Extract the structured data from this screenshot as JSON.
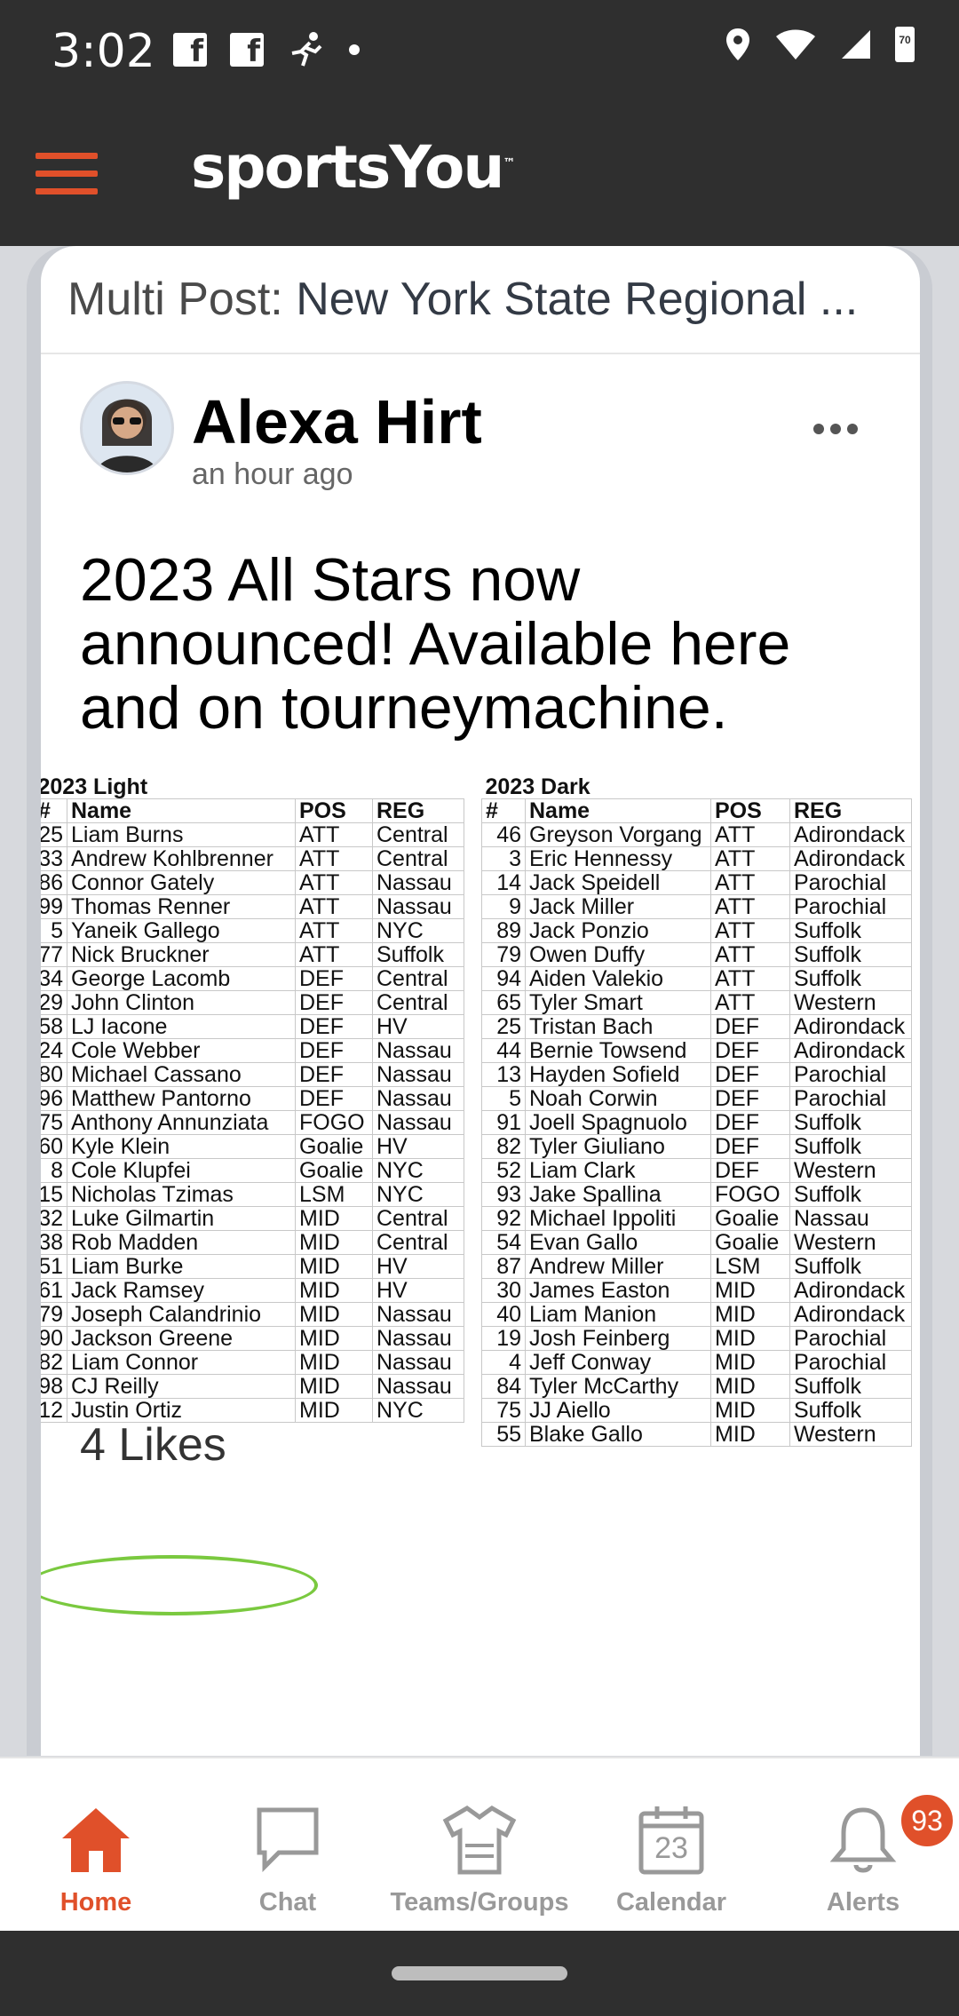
{
  "status": {
    "time": "3:02",
    "battery": "70"
  },
  "app": {
    "brand": "sportsYou",
    "brand_mark": "™"
  },
  "post": {
    "multi_prefix": "Multi Post:",
    "multi_title": "New York State Regional ...",
    "author": "Alexa Hirt",
    "time": "an hour ago",
    "text": "2023 All Stars now announced! Available here and on tourneymachine.",
    "likes": "4 Likes"
  },
  "light_table": {
    "title": "2023 Light",
    "headers": [
      "#",
      "Name",
      "POS",
      "REG"
    ],
    "rows": [
      [
        "25",
        "Liam Burns",
        "ATT",
        "Central"
      ],
      [
        "33",
        "Andrew Kohlbrenner",
        "ATT",
        "Central"
      ],
      [
        "86",
        "Connor Gately",
        "ATT",
        "Nassau"
      ],
      [
        "99",
        "Thomas Renner",
        "ATT",
        "Nassau"
      ],
      [
        "5",
        "Yaneik Gallego",
        "ATT",
        "NYC"
      ],
      [
        "77",
        "Nick Bruckner",
        "ATT",
        "Suffolk"
      ],
      [
        "34",
        "George Lacomb",
        "DEF",
        "Central"
      ],
      [
        "29",
        "John Clinton",
        "DEF",
        "Central"
      ],
      [
        "58",
        "LJ Iacone",
        "DEF",
        "HV"
      ],
      [
        "24",
        "Cole Webber",
        "DEF",
        "Nassau"
      ],
      [
        "80",
        "Michael Cassano",
        "DEF",
        "Nassau"
      ],
      [
        "96",
        "Matthew Pantorno",
        "DEF",
        "Nassau"
      ],
      [
        "75",
        "Anthony Annunziata",
        "FOGO",
        "Nassau"
      ],
      [
        "60",
        "Kyle Klein",
        "Goalie",
        "HV"
      ],
      [
        "8",
        "Cole Klupfei",
        "Goalie",
        "NYC"
      ],
      [
        "15",
        "Nicholas Tzimas",
        "LSM",
        "NYC"
      ],
      [
        "32",
        "Luke Gilmartin",
        "MID",
        "Central"
      ],
      [
        "38",
        "Rob Madden",
        "MID",
        "Central"
      ],
      [
        "51",
        "Liam Burke",
        "MID",
        "HV"
      ],
      [
        "61",
        "Jack Ramsey",
        "MID",
        "HV"
      ],
      [
        "79",
        "Joseph Calandrinio",
        "MID",
        "Nassau"
      ],
      [
        "90",
        "Jackson Greene",
        "MID",
        "Nassau"
      ],
      [
        "82",
        "Liam Connor",
        "MID",
        "Nassau"
      ],
      [
        "98",
        "CJ Reilly",
        "MID",
        "Nassau"
      ],
      [
        "12",
        "Justin Ortiz",
        "MID",
        "NYC"
      ]
    ]
  },
  "dark_table": {
    "title": "2023 Dark",
    "headers": [
      "#",
      "Name",
      "POS",
      "REG"
    ],
    "rows": [
      [
        "46",
        "Greyson Vorgang",
        "ATT",
        "Adirondack"
      ],
      [
        "3",
        "Eric Hennessy",
        "ATT",
        "Adirondack"
      ],
      [
        "14",
        "Jack Speidell",
        "ATT",
        "Parochial"
      ],
      [
        "9",
        "Jack Miller",
        "ATT",
        "Parochial"
      ],
      [
        "89",
        "Jack Ponzio",
        "ATT",
        "Suffolk"
      ],
      [
        "79",
        "Owen Duffy",
        "ATT",
        "Suffolk"
      ],
      [
        "94",
        "Aiden Valekio",
        "ATT",
        "Suffolk"
      ],
      [
        "65",
        "Tyler Smart",
        "ATT",
        "Western"
      ],
      [
        "25",
        "Tristan Bach",
        "DEF",
        "Adirondack"
      ],
      [
        "44",
        "Bernie Towsend",
        "DEF",
        "Adirondack"
      ],
      [
        "13",
        "Hayden Sofield",
        "DEF",
        "Parochial"
      ],
      [
        "5",
        "Noah Corwin",
        "DEF",
        "Parochial"
      ],
      [
        "91",
        "Joell Spagnuolo",
        "DEF",
        "Suffolk"
      ],
      [
        "82",
        "Tyler Giuliano",
        "DEF",
        "Suffolk"
      ],
      [
        "52",
        "Liam Clark",
        "DEF",
        "Western"
      ],
      [
        "93",
        "Jake Spallina",
        "FOGO",
        "Suffolk"
      ],
      [
        "92",
        "Michael Ippoliti",
        "Goalie",
        "Nassau"
      ],
      [
        "54",
        "Evan Gallo",
        "Goalie",
        "Western"
      ],
      [
        "87",
        "Andrew Miller",
        "LSM",
        "Suffolk"
      ],
      [
        "30",
        "James Easton",
        "MID",
        "Adirondack"
      ],
      [
        "40",
        "Liam Manion",
        "MID",
        "Adirondack"
      ],
      [
        "19",
        "Josh Feinberg",
        "MID",
        "Parochial"
      ],
      [
        "4",
        "Jeff Conway",
        "MID",
        "Parochial"
      ],
      [
        "84",
        "Tyler McCarthy",
        "MID",
        "Suffolk"
      ],
      [
        "75",
        "JJ Aiello",
        "MID",
        "Suffolk"
      ],
      [
        "55",
        "Blake Gallo",
        "MID",
        "Western"
      ]
    ]
  },
  "tabs": [
    {
      "label": "Home",
      "icon": "home-icon"
    },
    {
      "label": "Chat",
      "icon": "chat-icon"
    },
    {
      "label": "Teams/Groups",
      "icon": "jersey-icon"
    },
    {
      "label": "Calendar",
      "icon": "calendar-icon",
      "day": "23"
    },
    {
      "label": "Alerts",
      "icon": "bell-icon",
      "badge": "93"
    }
  ],
  "colors": {
    "accent": "#e0502a",
    "bar": "#2f2f2f",
    "highlight": "#7ac93f"
  }
}
